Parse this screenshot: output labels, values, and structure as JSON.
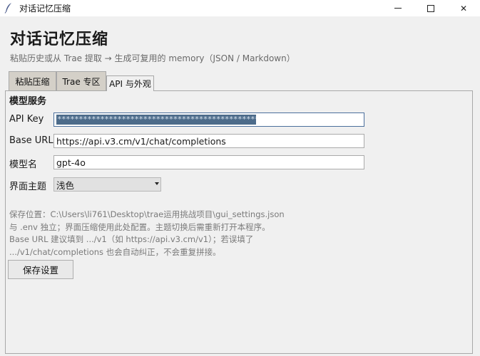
{
  "window": {
    "title": "对话记忆压缩",
    "minimize_symbol": "",
    "close_symbol": "✕"
  },
  "header": {
    "heading": "对话记忆压缩",
    "subtitle": "粘贴历史或从 Trae 提取 → 生成可复用的 memory（JSON / Markdown）"
  },
  "tabs": [
    {
      "label": "粘贴压缩",
      "active": false
    },
    {
      "label": "Trae 专区",
      "active": false
    },
    {
      "label": "API 与外观",
      "active": true
    }
  ],
  "panel": {
    "section_title": "模型服务",
    "fields": {
      "api_key": {
        "label": "API Key",
        "value": "************************************************"
      },
      "base_url": {
        "label": "Base URL",
        "value": "https://api.v3.cm/v1/chat/completions"
      },
      "model": {
        "label": "模型名",
        "value": "gpt-4o"
      },
      "theme": {
        "label": "界面主题",
        "value": "浅色"
      }
    },
    "note_lines": [
      "保存位置：C:\\Users\\li761\\Desktop\\trae运用挑战项目\\gui_settings.json",
      "与 .env 独立；界面压缩使用此处配置。主题切换后需重新打开本程序。",
      "Base URL 建议填到 .../v1（如 https://api.v3.cm/v1）；若误填了",
      ".../v1/chat/completions 也会自动纠正，不会重复拼接。"
    ],
    "save_button": "保存设置"
  },
  "colors": {
    "selection": "#4c6b8a",
    "tab_inactive": "#d4d0c8",
    "background": "#f0f0f0"
  }
}
